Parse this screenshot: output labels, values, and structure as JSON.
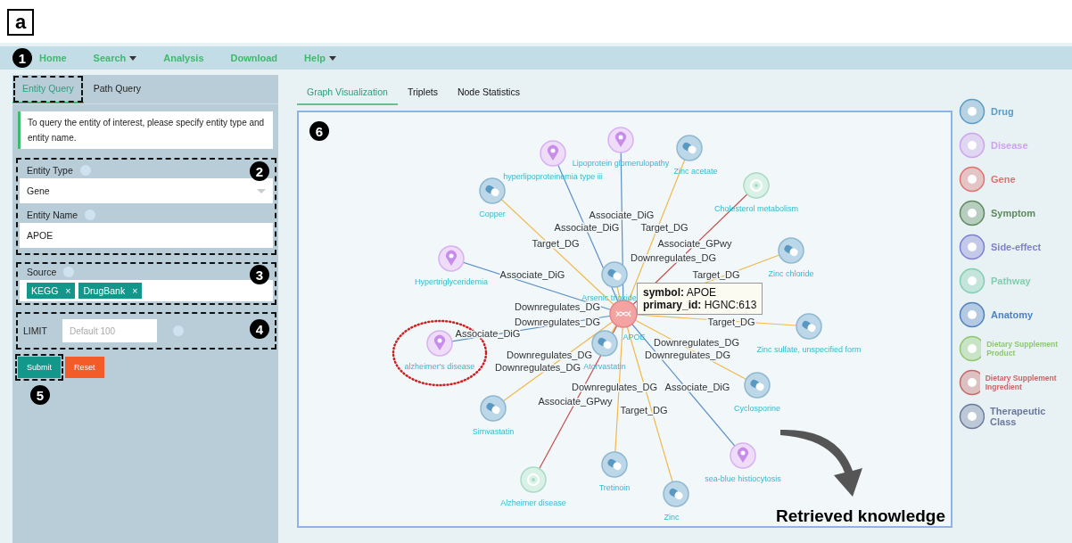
{
  "figure_label": "a",
  "nav": {
    "marker": "1",
    "items": [
      {
        "label": "Home",
        "dropdown": false
      },
      {
        "label": "Search",
        "dropdown": true
      },
      {
        "label": "Analysis",
        "dropdown": false
      },
      {
        "label": "Download",
        "dropdown": false
      },
      {
        "label": "Help",
        "dropdown": true
      }
    ]
  },
  "query_tabs": [
    {
      "label": "Entity Query",
      "selected": true
    },
    {
      "label": "Path Query",
      "selected": false
    }
  ],
  "info": "To query the entity of interest, please specify entity type and entity name.",
  "entity_fields": {
    "marker": "2",
    "type_label": "Entity Type",
    "type_value": "Gene",
    "name_label": "Entity Name",
    "name_value": "APOE"
  },
  "source": {
    "marker": "3",
    "label": "Source",
    "tags": [
      {
        "label": "KEGG",
        "remove": "×"
      },
      {
        "label": "DrugBank",
        "remove": "×"
      }
    ]
  },
  "limit": {
    "marker": "4",
    "label": "LIMIT",
    "placeholder": "Default 100"
  },
  "actions": {
    "marker": "5",
    "buttons": [
      {
        "label": "Submit",
        "kind": "primary"
      },
      {
        "label": "Reset",
        "kind": "danger"
      }
    ]
  },
  "view_tabs": [
    {
      "label": "Graph Visualization",
      "selected": true
    },
    {
      "label": "Triplets",
      "selected": false
    },
    {
      "label": "Node Statistics",
      "selected": false
    }
  ],
  "graph": {
    "marker": "6",
    "nodes": [
      {
        "label": "hyperlipoproteinemia type iii",
        "kind": "disease",
        "circled": false
      },
      {
        "label": "Lipoprotein glomerulopathy",
        "kind": "disease",
        "circled": false
      },
      {
        "label": "Zinc acetate",
        "kind": "drug",
        "circled": false
      },
      {
        "label": "Copper",
        "kind": "drug",
        "circled": false
      },
      {
        "label": "Cholesterol metabolism",
        "kind": "pathway",
        "circled": false
      },
      {
        "label": "Hypertriglyceridemia",
        "kind": "disease",
        "circled": false
      },
      {
        "label": "Zinc chloride",
        "kind": "drug",
        "circled": false
      },
      {
        "label": "Arsenic trioxide",
        "kind": "drug",
        "circled": false
      },
      {
        "label": "Zinc sulfate, unspecified form",
        "kind": "drug",
        "circled": false
      },
      {
        "label": "alzheimer's disease",
        "kind": "disease",
        "circled": true
      },
      {
        "label": "Atorvastatin",
        "kind": "drug",
        "circled": false
      },
      {
        "label": "Cyclosporine",
        "kind": "drug",
        "circled": false
      },
      {
        "label": "Simvastatin",
        "kind": "drug",
        "circled": false
      },
      {
        "label": "Alzheimer disease",
        "kind": "pathway",
        "circled": false
      },
      {
        "label": "Tretinoin",
        "kind": "drug",
        "circled": false
      },
      {
        "label": "Zinc",
        "kind": "drug",
        "circled": false
      },
      {
        "label": "sea-blue histiocytosis",
        "kind": "disease",
        "circled": false
      },
      {
        "label": "APOE",
        "kind": "gene",
        "circled": false
      }
    ],
    "edges": [
      {
        "label": "Associate_DiG"
      },
      {
        "label": "Associate_DiG"
      },
      {
        "label": "Target_DG"
      },
      {
        "label": "Target_DG"
      },
      {
        "label": "Associate_GPwy"
      },
      {
        "label": "Downregulates_DG"
      },
      {
        "label": "Associate_DiG"
      },
      {
        "label": "Target_DG"
      },
      {
        "label": "Downregulates_DG"
      },
      {
        "label": "Downregulates_DG"
      },
      {
        "label": "Target_DG"
      },
      {
        "label": "Associate_DiG"
      },
      {
        "label": "Downregulates_DG"
      },
      {
        "label": "Downregulates_DG"
      },
      {
        "label": "Downregulates_DG"
      },
      {
        "label": "Downregulates_DG"
      },
      {
        "label": "Downregulates_DG"
      },
      {
        "label": "Associate_DiG"
      },
      {
        "label": "Associate_GPwy"
      },
      {
        "label": "Target_DG"
      }
    ],
    "tooltip": [
      "**symbol:** APOE",
      "**primary_id:** HGNC:613"
    ],
    "caption": "Retrieved knowledge"
  },
  "legend": [
    {
      "label": "Drug",
      "color": "#5b9cc4",
      "kind": "single"
    },
    {
      "label": "Disease",
      "color": "#cfa2ee",
      "kind": "single"
    },
    {
      "label": "Gene",
      "color": "#e0716e",
      "kind": "single"
    },
    {
      "label": "Symptom",
      "color": "#5d8a5d",
      "kind": "single"
    },
    {
      "label": "Side-effect",
      "color": "#7d7fd3",
      "kind": "single"
    },
    {
      "label": "Pathway",
      "color": "#80cfae",
      "kind": "single"
    },
    {
      "label": "Anatomy",
      "color": "#4f80c0",
      "kind": "single"
    },
    {
      "label": "Dietary Supplement Product",
      "color": "#8dc86f",
      "kind": "double"
    },
    {
      "label": "Dietary Supplement Ingredient",
      "color": "#c56868",
      "kind": "double"
    },
    {
      "label": "Therapeutic Class",
      "color": "#6a7a9c",
      "kind": "single"
    }
  ]
}
